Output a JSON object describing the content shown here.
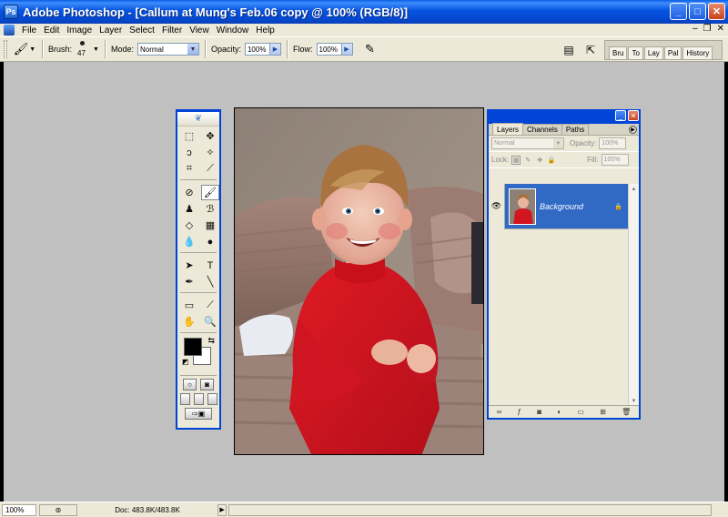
{
  "window": {
    "title": "Adobe Photoshop - [Callum at Mung's Feb.06 copy @ 100% (RGB/8)]",
    "controls": [
      "minimize",
      "maximize",
      "close"
    ]
  },
  "menu": {
    "items": [
      "File",
      "Edit",
      "Image",
      "Layer",
      "Select",
      "Filter",
      "View",
      "Window",
      "Help"
    ]
  },
  "options": {
    "brush_label": "Brush:",
    "brush_size": "47",
    "mode_label": "Mode:",
    "mode_value": "Normal",
    "opacity_label": "Opacity:",
    "opacity_value": "100%",
    "flow_label": "Flow:",
    "flow_value": "100%",
    "palette_well_tabs": [
      "Bru",
      "To",
      "Lay",
      "Pal",
      "History"
    ]
  },
  "layers_panel": {
    "tabs": [
      "Layers",
      "Channels",
      "Paths"
    ],
    "active_tab": "Layers",
    "blend_mode": "Normal",
    "opacity_label": "Opacity:",
    "opacity_value": "100%",
    "lock_label": "Lock:",
    "fill_label": "Fill:",
    "fill_value": "100%",
    "layers": [
      {
        "name": "Background",
        "visible": true,
        "locked": true,
        "selected": true
      }
    ]
  },
  "statusbar": {
    "zoom": "100%",
    "doc_info": "Doc: 483.8K/483.8K"
  },
  "colors": {
    "foreground": "#000000",
    "background": "#ffffff",
    "workspace": "#c0c0c0",
    "accent": "#0045d6",
    "selection": "#316ac5"
  }
}
